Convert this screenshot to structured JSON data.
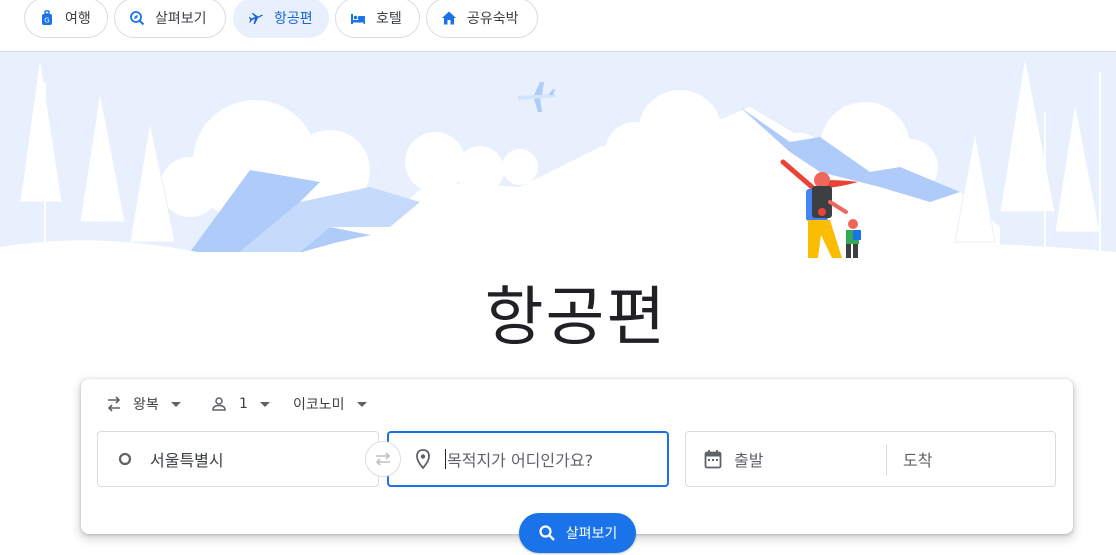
{
  "nav": {
    "items": [
      {
        "label": "여행",
        "icon": "luggage-icon"
      },
      {
        "label": "살펴보기",
        "icon": "explore-icon"
      },
      {
        "label": "항공편",
        "icon": "airplane-icon",
        "active": true
      },
      {
        "label": "호텔",
        "icon": "bed-icon"
      },
      {
        "label": "공유숙박",
        "icon": "house-icon"
      }
    ]
  },
  "page": {
    "title": "항공편"
  },
  "search": {
    "trip_type": "왕복",
    "passengers": "1",
    "cabin_class": "이코노미",
    "origin": "서울특별시",
    "destination_placeholder": "목적지가 어디인가요?",
    "depart_placeholder": "출발",
    "return_placeholder": "도착",
    "search_label": "살펴보기"
  },
  "colors": {
    "accent": "#1a73e8",
    "active_chip_bg": "#e8f0fe",
    "hero_blue": "#aecbfa",
    "hero_light": "#e8f0fe"
  }
}
